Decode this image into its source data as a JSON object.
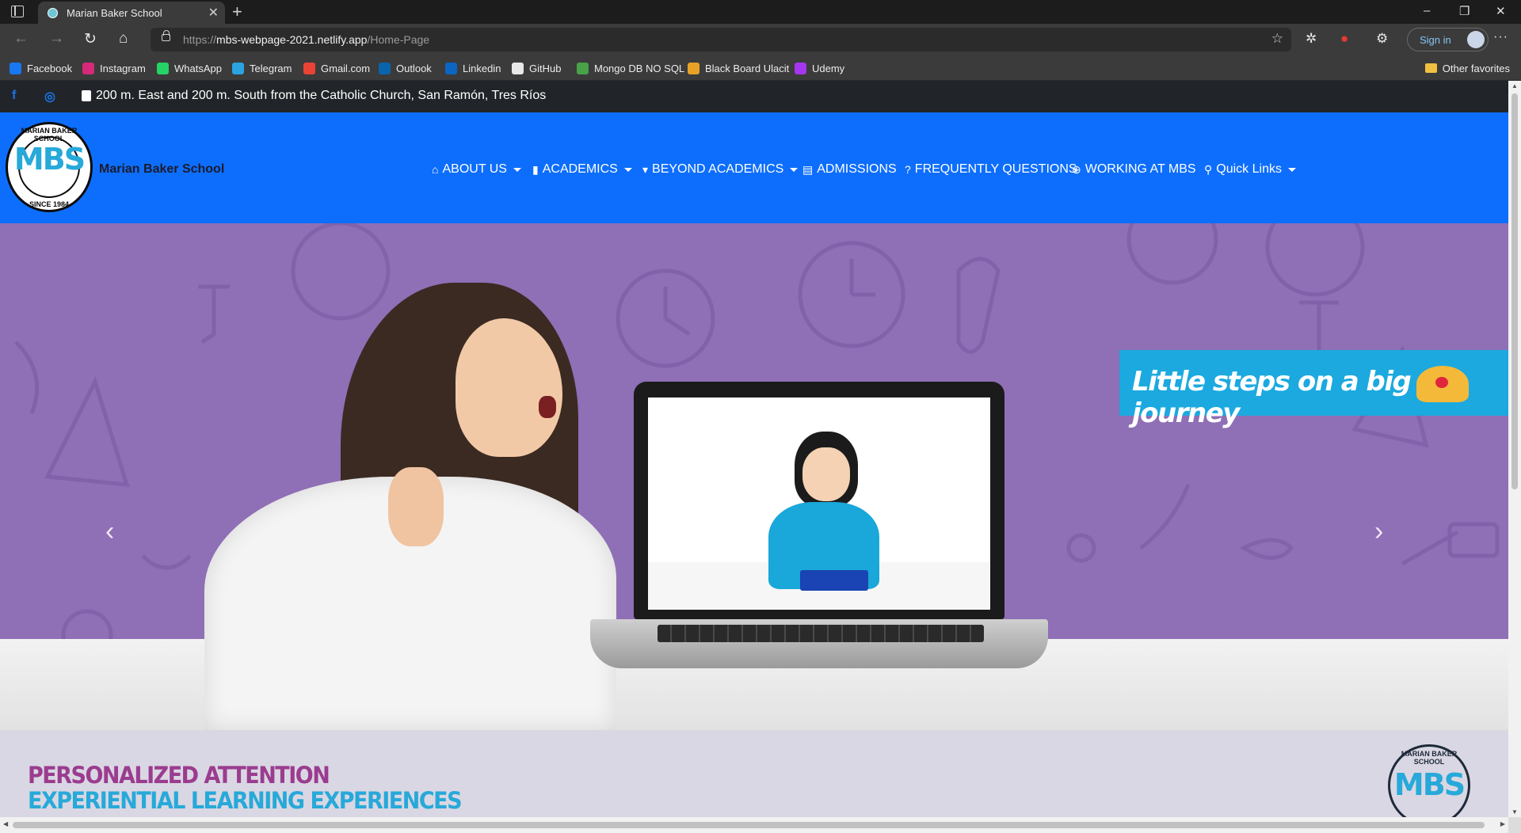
{
  "browser": {
    "tab": {
      "title": "Marian Baker School"
    },
    "new_tab_glyph": "+",
    "tab_close_glyph": "✕",
    "window_controls": {
      "minimize": "–",
      "restore": "❐",
      "close": "✕"
    },
    "address": {
      "scheme": "https://",
      "host": "mbs-webpage-2021.netlify.app",
      "path": "/Home-Page"
    },
    "sign_in": "Sign in",
    "more_glyph": "···",
    "bookmarks": [
      {
        "label": "Facebook",
        "icon": "facebook-icon",
        "color": "#1877f2"
      },
      {
        "label": "Instagram",
        "icon": "instagram-icon",
        "color": "#d6297a"
      },
      {
        "label": "WhatsApp",
        "icon": "whatsapp-icon",
        "color": "#25d366"
      },
      {
        "label": "Telegram",
        "icon": "telegram-icon",
        "color": "#2aa3e0"
      },
      {
        "label": "Gmail.com",
        "icon": "gmail-icon",
        "color": "#ea4335"
      },
      {
        "label": "Outlook",
        "icon": "outlook-icon",
        "color": "#0a64ad"
      },
      {
        "label": "Linkedin",
        "icon": "linkedin-icon",
        "color": "#0a66c2"
      },
      {
        "label": "GitHub",
        "icon": "github-icon",
        "color": "#e8e8e8"
      },
      {
        "label": "Mongo DB NO SQL",
        "icon": "mongodb-icon",
        "color": "#47a248"
      },
      {
        "label": "Black Board Ulacit",
        "icon": "blackboard-icon",
        "color": "#e8a126"
      },
      {
        "label": "Udemy",
        "icon": "udemy-icon",
        "color": "#a435f0"
      }
    ],
    "other_favorites": "Other favorites"
  },
  "topbar": {
    "address": "200 m. East and 200 m. South from the Catholic Church, San Ramón, Tres Ríos",
    "facebook_glyph": "f",
    "instagram_glyph": "◎"
  },
  "navbar": {
    "brand": "Marian Baker School",
    "logo": {
      "monogram": "MBS",
      "arc_top": "MARIAN BAKER SCHOOL",
      "arc_bottom": "SINCE 1984"
    },
    "items": [
      {
        "label": "ABOUT US",
        "icon": "home-icon",
        "glyph": "⌂",
        "dropdown": true
      },
      {
        "label": "ACADEMICS",
        "icon": "building-icon",
        "glyph": "▮",
        "dropdown": true
      },
      {
        "label": "BEYOND ACADEMICS",
        "icon": "bookmark-icon",
        "glyph": "▾",
        "dropdown": true
      },
      {
        "label": "ADMISSIONS",
        "icon": "book-icon",
        "glyph": "▤",
        "dropdown": false
      },
      {
        "label": "FREQUENTLY QUESTIONS",
        "icon": "question-icon",
        "glyph": "?",
        "dropdown": false
      },
      {
        "label": "WORKING AT MBS",
        "icon": "search-plus-icon",
        "glyph": "⊕",
        "dropdown": false
      },
      {
        "label": "Quick Links",
        "icon": "search-icon",
        "glyph": "⚲",
        "dropdown": true
      }
    ]
  },
  "hero": {
    "banner_text": "Little steps on a big journey",
    "prev_glyph": "‹",
    "next_glyph": "›"
  },
  "band": {
    "line1": "PERSONALIZED ATTENTION",
    "line2": "EXPERIENTIAL LEARNING EXPERIENCES",
    "logo_monogram": "MBS",
    "logo_arc": "MARIAN BAKER SCHOOL"
  },
  "colors": {
    "navbar": "#0d6efd",
    "topbar": "#212529",
    "hero_bg": "#8f6fb6",
    "banner": "#1ba9df",
    "accent_purple": "#9b3c8f",
    "accent_cyan": "#27a9d9"
  }
}
